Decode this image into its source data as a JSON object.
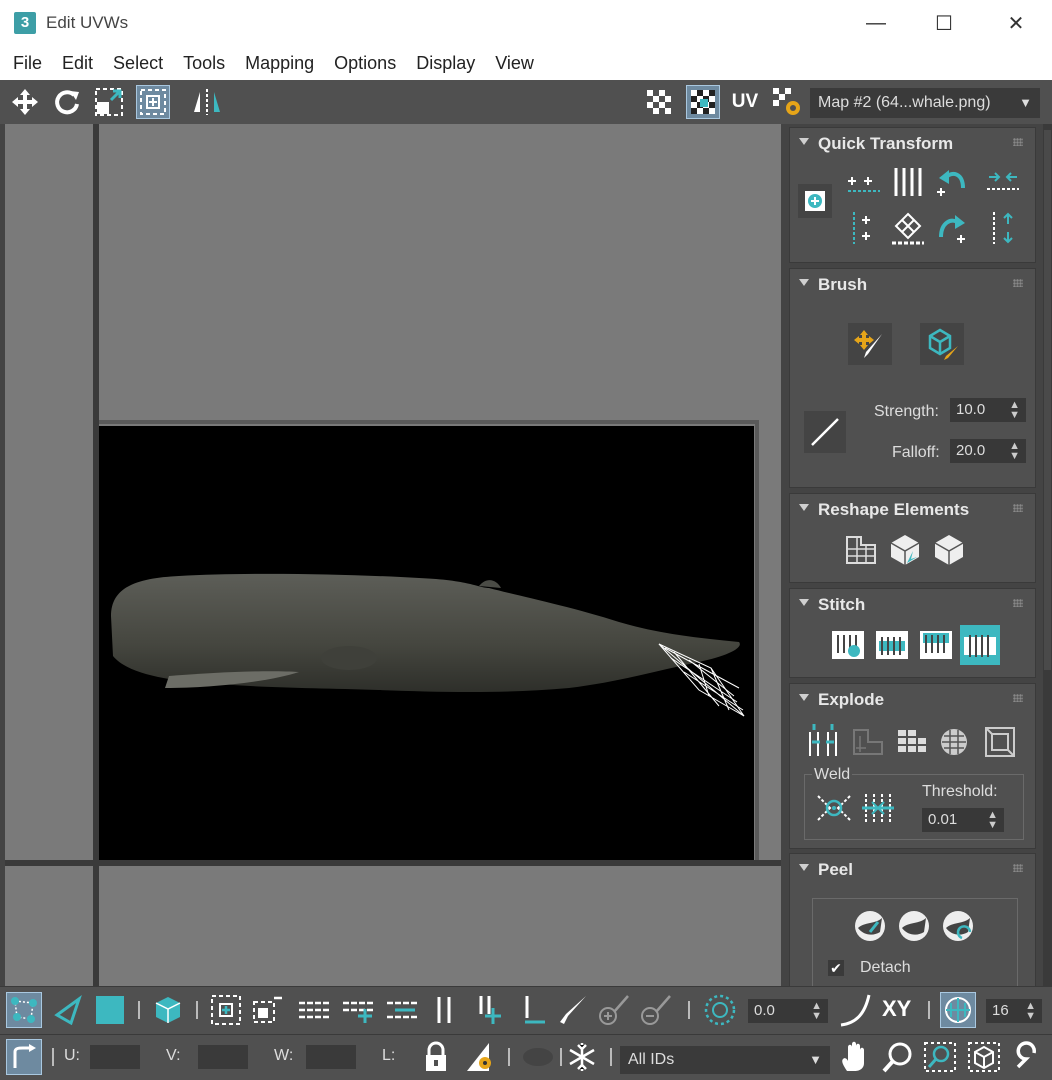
{
  "window": {
    "app_icon": "3",
    "title": "Edit UVWs",
    "minimize": "—",
    "maximize": "☐",
    "close": "✕"
  },
  "menu": [
    "File",
    "Edit",
    "Select",
    "Tools",
    "Mapping",
    "Options",
    "Display",
    "View"
  ],
  "toolbar": {
    "uv_label": "UV",
    "map_select": "Map #2 (64...whale.png)"
  },
  "quick_transform": {
    "title": "Quick Transform"
  },
  "brush": {
    "title": "Brush",
    "strength_label": "Strength:",
    "strength_value": "10.0",
    "falloff_label": "Falloff:",
    "falloff_value": "20.0"
  },
  "reshape": {
    "title": "Reshape Elements"
  },
  "stitch": {
    "title": "Stitch"
  },
  "explode": {
    "title": "Explode",
    "weld_label": "Weld",
    "threshold_label": "Threshold:",
    "threshold_value": "0.01"
  },
  "peel": {
    "title": "Peel",
    "detach_label": "Detach",
    "detach_checked": true
  },
  "bottom": {
    "rotation_value": "0.0",
    "xy_label": "XY",
    "grid_value": "16",
    "u_label": "U:",
    "v_label": "V:",
    "w_label": "W:",
    "l_label": "L:",
    "ids_select": "All IDs"
  },
  "colors": {
    "accent": "#3db8c0",
    "panel": "#505050",
    "viewport": "#7a7a7a"
  }
}
